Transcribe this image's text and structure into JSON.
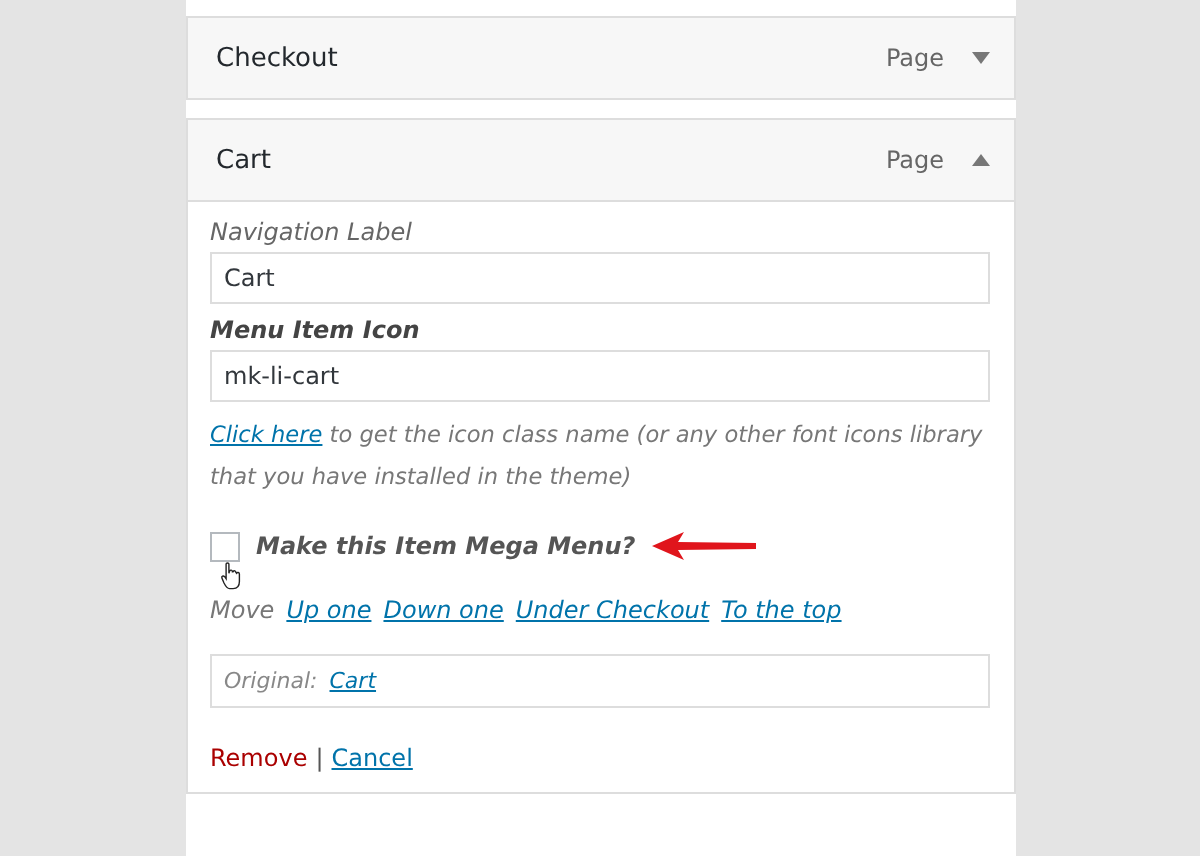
{
  "menu_items": [
    {
      "title": "Checkout",
      "type": "Page",
      "expanded": false
    },
    {
      "title": "Cart",
      "type": "Page",
      "expanded": true,
      "settings": {
        "navigation_label": {
          "label": "Navigation Label",
          "value": "Cart"
        },
        "menu_item_icon": {
          "label": "Menu Item Icon",
          "value": "mk-li-cart"
        },
        "help": {
          "link": "Click here",
          "text": " to get the icon class name (or any other font icons library that you have installed in the theme)"
        },
        "mega_menu": {
          "label": "Make this Item Mega Menu?",
          "checked": false
        },
        "move": {
          "label": "Move",
          "links": [
            "Up one",
            "Down one",
            "Under Checkout",
            "To the top"
          ]
        },
        "original": {
          "label": "Original:",
          "link": "Cart"
        },
        "actions": {
          "remove": "Remove",
          "separator": "|",
          "cancel": "Cancel"
        }
      }
    }
  ]
}
